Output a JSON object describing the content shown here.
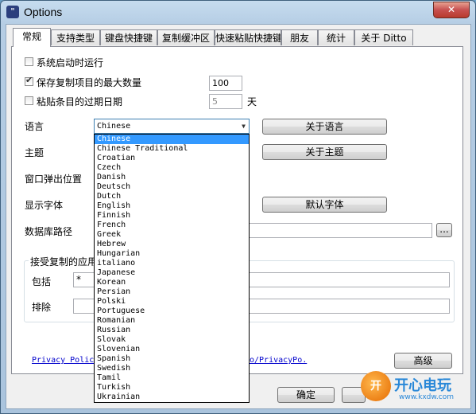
{
  "window": {
    "title": "Options",
    "close_glyph": "✕",
    "icon_glyph": "\""
  },
  "tabs": [
    {
      "label": "常规"
    },
    {
      "label": "支持类型"
    },
    {
      "label": "键盘快捷键"
    },
    {
      "label": "复制缓冲区"
    },
    {
      "label": "快速粘贴快捷键"
    },
    {
      "label": "朋友"
    },
    {
      "label": "统计"
    },
    {
      "label": "关于 Ditto"
    }
  ],
  "general": {
    "startup_label": "系统启动时运行",
    "startup_checked": false,
    "max_copies_label": "保存复制项目的最大数量",
    "max_copies_checked": true,
    "max_copies_value": "100",
    "expire_label": "粘贴条目的过期日期",
    "expire_checked": false,
    "expire_value": "5",
    "expire_unit": "天",
    "language_label": "语言",
    "language_selected": "Chinese",
    "about_language_button": "关于语言",
    "theme_label": "主题",
    "about_theme_button": "关于主题",
    "popup_position_label": "窗口弹出位置",
    "display_font_label": "显示字体",
    "default_font_button": "默认字体",
    "db_path_label": "数据库路径",
    "db_path_value": "",
    "browse_button": "...",
    "accepted_apps_group": "接受复制的应用",
    "include_label": "包括",
    "include_value": "*",
    "exclude_label": "排除",
    "exclude_value": "",
    "privacy_link_left": "Privacy Polic",
    "privacy_link_right": "o/PrivacyPo.",
    "advanced_button": "高级",
    "ok_button": "确定"
  },
  "language_options": [
    "Chinese",
    "Chinese Traditional",
    "Croatian",
    "Czech",
    "Danish",
    "Deutsch",
    "Dutch",
    "English",
    "Finnish",
    "French",
    "Greek",
    "Hebrew",
    "Hungarian",
    "italiano",
    "Japanese",
    "Korean",
    "Persian",
    "Polski",
    "Portuguese",
    "Romanian",
    "Russian",
    "Slovak",
    "Slovenian",
    "Spanish",
    "Swedish",
    "Tamil",
    "Turkish",
    "Ukrainian"
  ],
  "watermark": {
    "logo": "开",
    "name": "开心电玩",
    "url": "www.kxdw.com"
  }
}
